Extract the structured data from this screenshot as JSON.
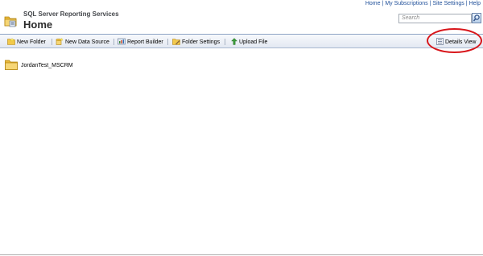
{
  "top_links": [
    "Home",
    "My Subscriptions",
    "Site Settings",
    "Help"
  ],
  "header": {
    "app_title": "SQL Server Reporting Services",
    "page_title": "Home",
    "icon": "folder-home-icon"
  },
  "search": {
    "placeholder": "Search",
    "button_icon": "search-icon"
  },
  "toolbar": {
    "new_folder": "New Folder",
    "new_data_source": "New Data Source",
    "report_builder": "Report Builder",
    "folder_settings": "Folder Settings",
    "upload_file": "Upload File",
    "details_view": "Details View"
  },
  "items": [
    {
      "name": "JordanTest_MSCRM",
      "icon": "folder-icon"
    }
  ],
  "colors": {
    "link": "#1f4f99",
    "toolbar_border": "#8ea4c4",
    "annotation_circle": "#d8161b",
    "folder_yellow": "#f2c94c"
  }
}
